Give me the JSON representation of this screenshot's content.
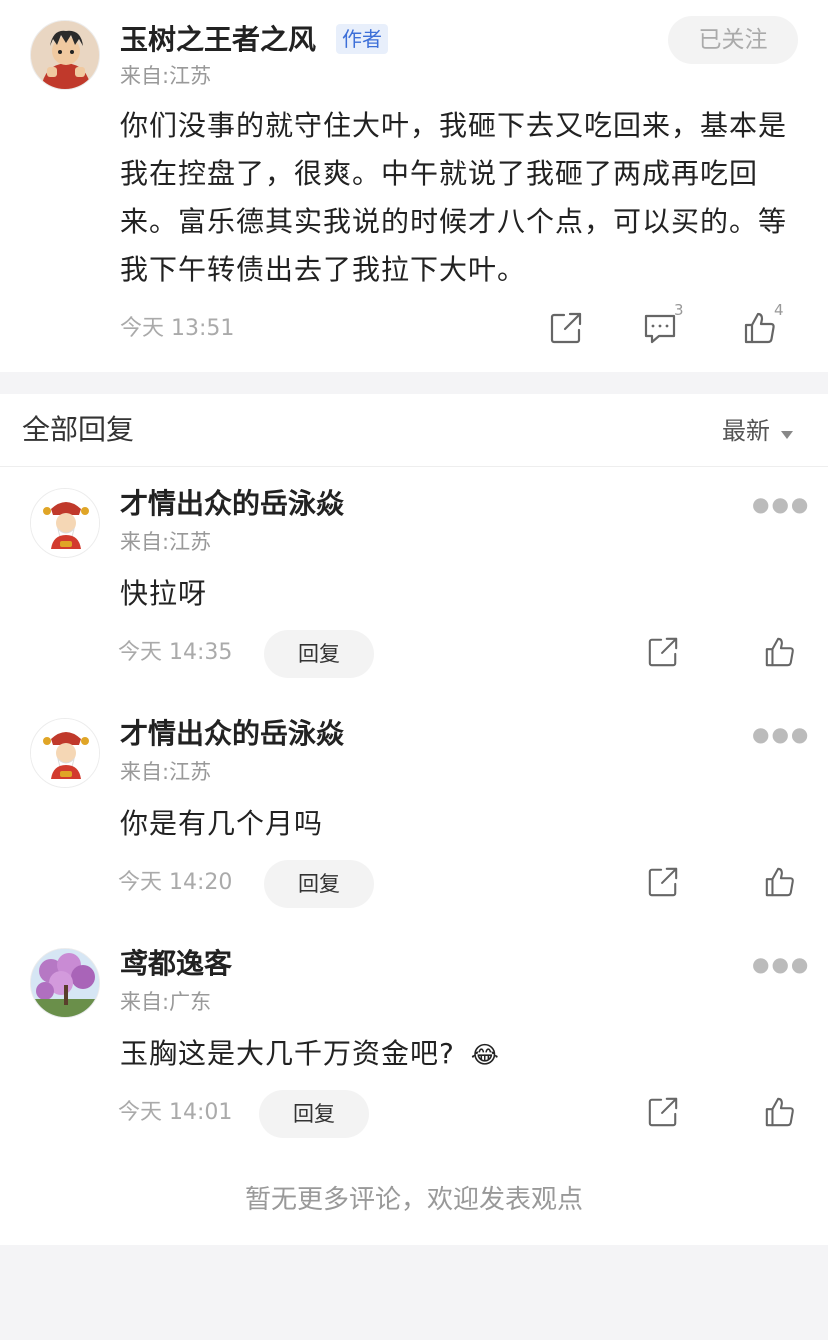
{
  "post": {
    "author": "玉树之王者之风",
    "author_badge": "作者",
    "follow_label": "已关注",
    "location": "来自:江苏",
    "content": "你们没事的就守住大叶，我砸下去又吃回来，基本是我在控盘了，很爽。中午就说了我砸了两成再吃回来。富乐德其实我说的时候才八个点，可以买的。等我下午转债出去了我拉下大叶。",
    "time": "今天 13:51",
    "comment_count": "3",
    "like_count": "4"
  },
  "replies_header": {
    "title": "全部回复",
    "sort_label": "最新"
  },
  "replies": [
    {
      "name": "才情出众的岳泳焱",
      "location": "来自:江苏",
      "content": "快拉呀",
      "time": "今天 14:35",
      "reply_label": "回复"
    },
    {
      "name": "才情出众的岳泳焱",
      "location": "来自:江苏",
      "content": "你是有几个月吗",
      "time": "今天 14:20",
      "reply_label": "回复"
    },
    {
      "name": "鸢都逸客",
      "location": "来自:广东",
      "content": "玉胸这是大几千万资金吧?",
      "emoji": "😂",
      "time": "今天 14:01",
      "reply_label": "回复"
    }
  ],
  "footer": {
    "no_more_text": "暂无更多评论，欢迎发表观点"
  },
  "colors": {
    "badge_bg": "#e8effb",
    "badge_text": "#3d6fd8",
    "page_bg": "#f4f4f6"
  }
}
